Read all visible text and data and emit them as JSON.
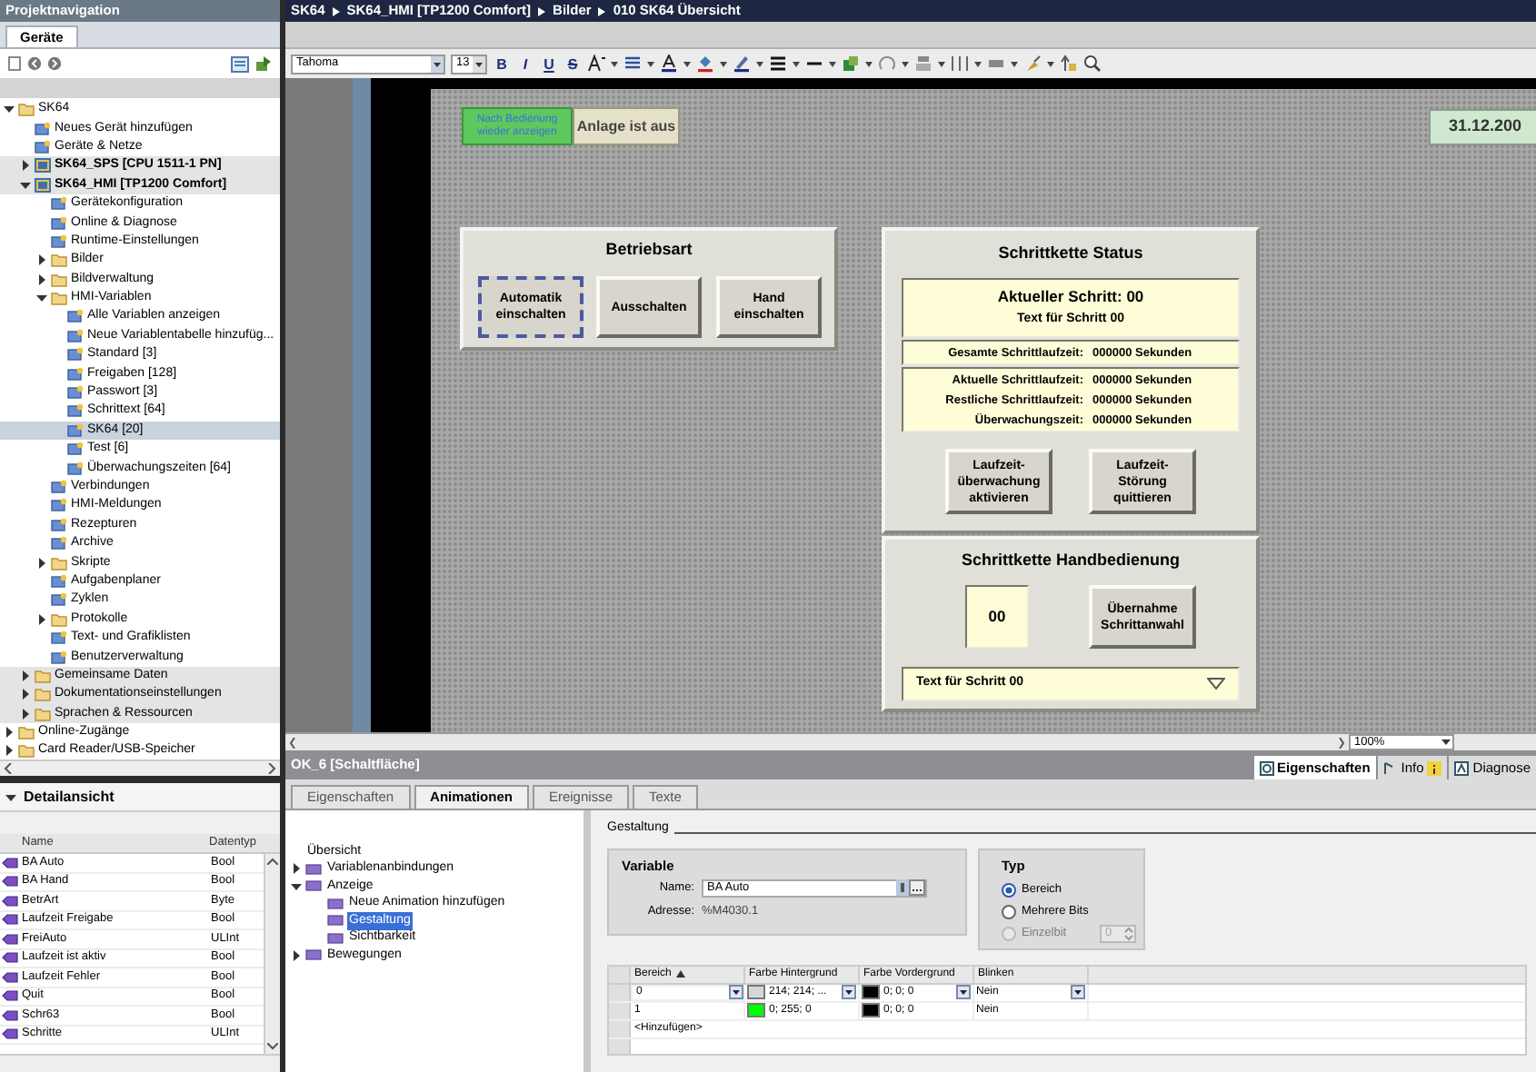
{
  "project_nav": {
    "title": "Projektnavigation",
    "tab": "Geräte",
    "tree": [
      {
        "label": "SK64",
        "kind": "item",
        "expanded": true,
        "selected": false,
        "children": [
          {
            "label": "Neues Gerät hinzufügen",
            "kind": "item",
            "selected": false
          },
          {
            "label": "Geräte & Netze",
            "kind": "item",
            "selected": false
          },
          {
            "label": "SK64_SPS [CPU 1511-1 PN]",
            "kind": "device",
            "expanded": false,
            "selected": false
          },
          {
            "label": "SK64_HMI [TP1200 Comfort]",
            "kind": "device",
            "expanded": true,
            "selected": false,
            "children": [
              {
                "label": "Gerätekonfiguration",
                "kind": "item",
                "selected": false
              },
              {
                "label": "Online & Diagnose",
                "kind": "item",
                "selected": false
              },
              {
                "label": "Runtime-Einstellungen",
                "kind": "item",
                "selected": false
              },
              {
                "label": "Bilder",
                "kind": "item",
                "expanded": false,
                "selected": false
              },
              {
                "label": "Bildverwaltung",
                "kind": "item",
                "expanded": false,
                "selected": false
              },
              {
                "label": "HMI-Variablen",
                "kind": "item",
                "expanded": true,
                "selected": false,
                "children": [
                  {
                    "label": "Alle Variablen anzeigen",
                    "kind": "item",
                    "selected": false
                  },
                  {
                    "label": "Neue Variablentabelle hinzufüg...",
                    "kind": "item",
                    "selected": false
                  },
                  {
                    "label": "Standard [3]",
                    "kind": "item",
                    "selected": false
                  },
                  {
                    "label": "Freigaben [128]",
                    "kind": "item",
                    "selected": false
                  },
                  {
                    "label": "Passwort [3]",
                    "kind": "item",
                    "selected": false
                  },
                  {
                    "label": "Schrittext [64]",
                    "kind": "item",
                    "selected": false
                  },
                  {
                    "label": "SK64 [20]",
                    "kind": "item",
                    "selected": true
                  },
                  {
                    "label": "Test [6]",
                    "kind": "item",
                    "selected": false
                  },
                  {
                    "label": "Überwachungszeiten [64]",
                    "kind": "item",
                    "selected": false
                  }
                ]
              },
              {
                "label": "Verbindungen",
                "kind": "item",
                "selected": false
              },
              {
                "label": "HMI-Meldungen",
                "kind": "item",
                "selected": false
              },
              {
                "label": "Rezepturen",
                "kind": "item",
                "selected": false
              },
              {
                "label": "Archive",
                "kind": "item",
                "selected": false
              },
              {
                "label": "Skripte",
                "kind": "item",
                "expanded": false,
                "selected": false
              },
              {
                "label": "Aufgabenplaner",
                "kind": "item",
                "selected": false
              },
              {
                "label": "Zyklen",
                "kind": "item",
                "selected": false
              },
              {
                "label": "Protokolle",
                "kind": "item",
                "expanded": false,
                "selected": false
              },
              {
                "label": "Text- und Grafiklisten",
                "kind": "item",
                "selected": false
              },
              {
                "label": "Benutzerverwaltung",
                "kind": "item",
                "selected": false
              }
            ]
          },
          {
            "label": "Gemeinsame Daten",
            "kind": "group",
            "expanded": false,
            "selected": false
          },
          {
            "label": "Dokumentationseinstellungen",
            "kind": "group",
            "expanded": false,
            "selected": false
          },
          {
            "label": "Sprachen & Ressourcen",
            "kind": "group",
            "expanded": false,
            "selected": false
          }
        ]
      },
      {
        "label": "Online-Zugänge",
        "kind": "item",
        "expanded": false,
        "selected": false
      },
      {
        "label": "Card Reader/USB-Speicher",
        "kind": "item",
        "expanded": false,
        "selected": false
      }
    ]
  },
  "detail_view": {
    "title": "Detailansicht",
    "columns": [
      "Name",
      "Datentyp"
    ],
    "rows": [
      {
        "name": "BA Auto",
        "type": "Bool"
      },
      {
        "name": "BA Hand",
        "type": "Bool"
      },
      {
        "name": "BetrArt",
        "type": "Byte"
      },
      {
        "name": "Laufzeit Freigabe",
        "type": "Bool"
      },
      {
        "name": "FreiAuto",
        "type": "ULInt"
      },
      {
        "name": "Laufzeit ist aktiv",
        "type": "Bool"
      },
      {
        "name": "Laufzeit Fehler",
        "type": "Bool"
      },
      {
        "name": "Quit",
        "type": "Bool"
      },
      {
        "name": "Schr63",
        "type": "Bool"
      },
      {
        "name": "Schritte",
        "type": "ULInt"
      }
    ]
  },
  "breadcrumb": [
    "SK64",
    "SK64_HMI [TP1200 Comfort]",
    "Bilder",
    "010 SK64 Übersicht"
  ],
  "format_toolbar": {
    "font": "Tahoma",
    "size": "13",
    "buttons": [
      "B",
      "I",
      "U",
      "S"
    ]
  },
  "hmi_screen": {
    "notice": "Nach Bedienung wieder anzeigen",
    "status": "Anlage ist aus",
    "date": "31.12.200",
    "mode_panel": {
      "title": "Betriebsart",
      "buttons": [
        {
          "label": "Automatik einschalten",
          "selected": true
        },
        {
          "label": "Ausschalten",
          "selected": false
        },
        {
          "label": "Hand einschalten",
          "selected": false
        }
      ]
    },
    "status_panel": {
      "title": "Schrittkette Status",
      "current_step": "Aktueller Schritt: 00",
      "step_text": "Text für Schritt 00",
      "total": {
        "label": "Gesamte Schrittlaufzeit:",
        "value": "000000 Sekunden"
      },
      "times": [
        {
          "label": "Aktuelle Schrittlaufzeit:",
          "value": "000000 Sekunden"
        },
        {
          "label": "Restliche Schrittlaufzeit:",
          "value": "000000 Sekunden"
        },
        {
          "label": "Überwachungszeit:",
          "value": "000000 Sekunden"
        }
      ],
      "buttons": [
        "Laufzeit- überwachung aktivieren",
        "Laufzeit- Störung quittieren"
      ]
    },
    "manual_panel": {
      "title": "Schrittkette Handbedienung",
      "step_field": "00",
      "button": "Übernahme Schrittanwahl",
      "dropdown": "Text für Schritt 00"
    }
  },
  "zoom": "100%",
  "properties": {
    "title": "OK_6 [Schaltfläche]",
    "side_tabs": [
      {
        "label": "Eigenschaften",
        "selected": true
      },
      {
        "label": "Info",
        "selected": false
      },
      {
        "label": "Diagnose",
        "selected": false
      }
    ],
    "tabs": [
      {
        "label": "Eigenschaften",
        "selected": false
      },
      {
        "label": "Animationen",
        "selected": true
      },
      {
        "label": "Ereignisse",
        "selected": false
      },
      {
        "label": "Texte",
        "selected": false
      }
    ],
    "nav": [
      {
        "label": "Übersicht",
        "selected": false
      },
      {
        "label": "Variablenanbindungen",
        "expanded": false,
        "selected": false
      },
      {
        "label": "Anzeige",
        "expanded": true,
        "selected": false,
        "children": [
          {
            "label": "Neue Animation hinzufügen",
            "selected": false
          },
          {
            "label": "Gestaltung",
            "selected": true
          },
          {
            "label": "Sichtbarkeit",
            "selected": false
          }
        ]
      },
      {
        "label": "Bewegungen",
        "expanded": false,
        "selected": false
      }
    ],
    "section": "Gestaltung",
    "variable": {
      "title": "Variable",
      "name_label": "Name:",
      "name": "BA Auto",
      "address_label": "Adresse:",
      "address": "%M4030.1"
    },
    "type": {
      "title": "Typ",
      "options": [
        {
          "label": "Bereich",
          "selected": true,
          "disabled": false
        },
        {
          "label": "Mehrere Bits",
          "selected": false,
          "disabled": false
        },
        {
          "label": "Einzelbit",
          "selected": false,
          "disabled": true
        }
      ],
      "bit": "0"
    },
    "table": {
      "columns": [
        "Bereich",
        "Farbe Hintergrund",
        "Farbe Vordergrund",
        "Blinken"
      ],
      "rows": [
        {
          "range": "0",
          "editing": true,
          "background": {
            "color": "#d6d6d6",
            "text": "214; 214; ..."
          },
          "foreground": {
            "color": "#000000",
            "text": "0; 0; 0"
          },
          "blink": "Nein"
        },
        {
          "range": "1",
          "editing": false,
          "background": {
            "color": "#00ff00",
            "text": "0; 255; 0"
          },
          "foreground": {
            "color": "#000000",
            "text": "0; 0; 0"
          },
          "blink": "Nein"
        }
      ],
      "add_row": "<Hinzufügen>"
    }
  }
}
